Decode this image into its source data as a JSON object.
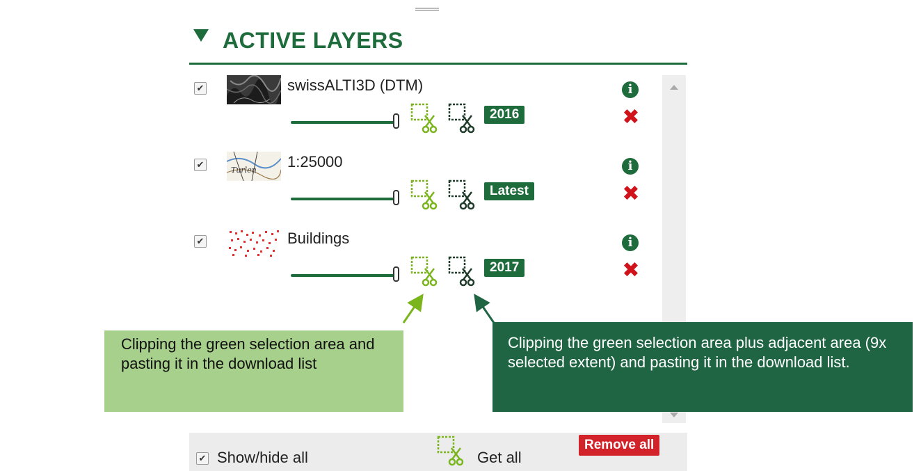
{
  "panel": {
    "title": "ACTIVE LAYERS"
  },
  "layers": [
    {
      "name": "swissALTI3D (DTM)",
      "year": "2016",
      "visible": true,
      "thumbnail": "terrain-hillshade-thumbnail"
    },
    {
      "name": "1:25000",
      "year": "Latest",
      "visible": true,
      "thumbnail": "topo-map-thumbnail"
    },
    {
      "name": "Buildings",
      "year": "2017",
      "visible": true,
      "thumbnail": "buildings-dots-thumbnail"
    }
  ],
  "icons": {
    "clip_selection": "clip-selection-icon",
    "clip_extended": "clip-extended-icon",
    "info": "info-icon",
    "remove": "remove-icon"
  },
  "callouts": {
    "light": "Clipping the green selection area and pasting it in the download list",
    "dark": "Clipping the green selection area plus adjacent area (9x selected extent) and pasting it in the download list."
  },
  "footer": {
    "show_hide_label": "Show/hide all",
    "get_all_label": "Get all",
    "remove_all_label": "Remove all"
  },
  "colors": {
    "brand_green": "#1e6b3c",
    "light_green_callout": "#a7d08c",
    "dark_green_callout": "#1f6543",
    "remove_red": "#d0121b",
    "clip_green": "#7ab51d"
  }
}
